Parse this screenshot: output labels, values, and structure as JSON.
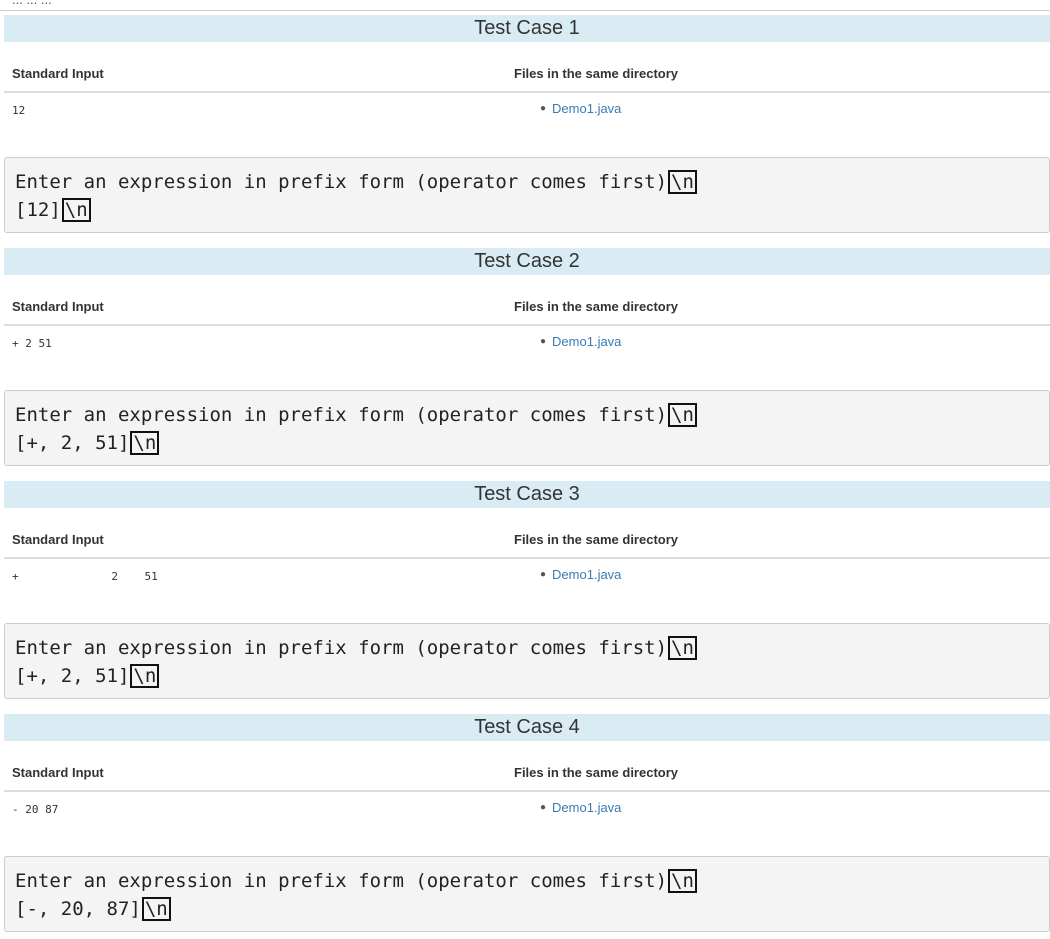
{
  "header": {
    "partial_text": "... ... ..."
  },
  "test_cases": [
    {
      "title": "Test Case 1",
      "stdin_label": "Standard Input",
      "files_label": "Files in the same directory",
      "stdin": "12",
      "files": [
        "Demo1.java"
      ],
      "output_line1": "Enter an expression in prefix form (operator comes first)",
      "output_line2": "[12]",
      "newline_marker": "\\n"
    },
    {
      "title": "Test Case 2",
      "stdin_label": "Standard Input",
      "files_label": "Files in the same directory",
      "stdin": "+ 2 51",
      "files": [
        "Demo1.java"
      ],
      "output_line1": "Enter an expression in prefix form (operator comes first)",
      "output_line2": "[+, 2, 51]",
      "newline_marker": "\\n"
    },
    {
      "title": "Test Case 3",
      "stdin_label": "Standard Input",
      "files_label": "Files in the same directory",
      "stdin": "+              2    51",
      "files": [
        "Demo1.java"
      ],
      "output_line1": "Enter an expression in prefix form (operator comes first)",
      "output_line2": "[+, 2, 51]",
      "newline_marker": "\\n"
    },
    {
      "title": "Test Case 4",
      "stdin_label": "Standard Input",
      "files_label": "Files in the same directory",
      "stdin": "- 20 87",
      "files": [
        "Demo1.java"
      ],
      "output_line1": "Enter an expression in prefix form (operator comes first)",
      "output_line2": "[-, 20, 87]",
      "newline_marker": "\\n"
    }
  ]
}
